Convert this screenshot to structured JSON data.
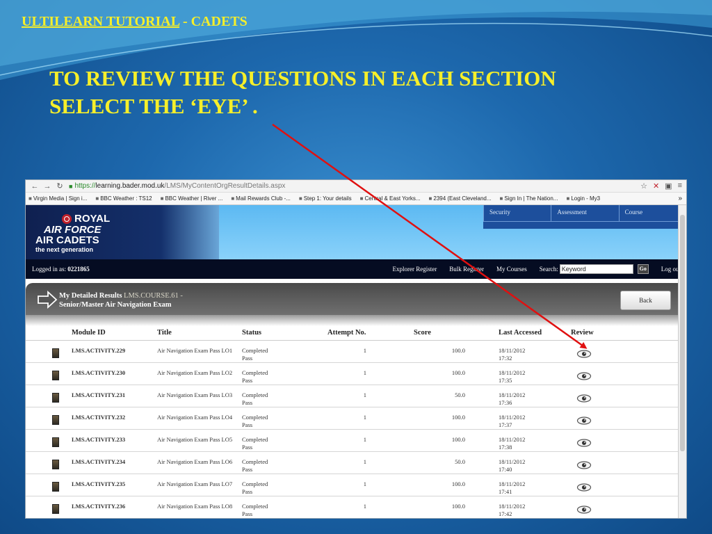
{
  "slide": {
    "title_underlined": "ULTILEARN TUTORIAL",
    "title_suffix": "- CADETS",
    "heading_line1": "TO REVIEW THE QUESTIONS IN EACH SECTION",
    "heading_line2": "SELECT THE ‘EYE’ ."
  },
  "browser": {
    "url_scheme": "https://",
    "url_host": "learning.bader.mod.uk",
    "url_path": "/LMS/MyContentOrgResultDetails.aspx",
    "bookmarks": [
      "Virgin Media | Sign i...",
      "BBC Weather : TS12",
      "BBC Weather | River ...",
      "Mail Rewards Club -...",
      "Step 1: Your details",
      "Central & East Yorks...",
      "2394 (East Cleveland...",
      "Sign In | The Nation...",
      "Login - My3"
    ],
    "bookmarks_more": "»"
  },
  "site": {
    "logo": {
      "line1": "ROYAL",
      "line2": "AIR FORCE",
      "line3": "AIR CADETS",
      "line4": "the next generation"
    },
    "top_tabs": [
      "Security",
      "Assessment",
      "Course"
    ],
    "logged_label": "Logged in as:",
    "user_id": "0221865",
    "menu": {
      "explorer": "Explorer Register",
      "bulk": "Bulk Register",
      "courses": "My Courses",
      "search_label": "Search:",
      "search_value": "Keyword",
      "go": "Go",
      "logout": "Log out"
    },
    "banner": {
      "label": "My Detailed Results",
      "course_code": "LMS.COURSE.61 -",
      "course_name": "Senior/Master Air Navigation Exam",
      "back": "Back"
    }
  },
  "table": {
    "headers": {
      "module_id": "Module ID",
      "title": "Title",
      "status": "Status",
      "attempt": "Attempt No.",
      "score": "Score",
      "last_accessed": "Last Accessed",
      "review": "Review"
    },
    "rows": [
      {
        "module": "LMS.ACTIVITY.229",
        "title": "Air Navigation Exam Pass LO1",
        "status1": "Completed",
        "status2": "Pass",
        "attempt": "1",
        "score": "100.0",
        "date": "18/11/2012",
        "time": "17:32"
      },
      {
        "module": "LMS.ACTIVITY.230",
        "title": "Air Navigation Exam Pass LO2",
        "status1": "Completed",
        "status2": "Pass",
        "attempt": "1",
        "score": "100.0",
        "date": "18/11/2012",
        "time": "17:35"
      },
      {
        "module": "LMS.ACTIVITY.231",
        "title": "Air Navigation Exam Pass LO3",
        "status1": "Completed",
        "status2": "Pass",
        "attempt": "1",
        "score": "50.0",
        "date": "18/11/2012",
        "time": "17:36"
      },
      {
        "module": "LMS.ACTIVITY.232",
        "title": "Air Navigation Exam Pass LO4",
        "status1": "Completed",
        "status2": "Pass",
        "attempt": "1",
        "score": "100.0",
        "date": "18/11/2012",
        "time": "17:37"
      },
      {
        "module": "LMS.ACTIVITY.233",
        "title": "Air Navigation Exam Pass LO5",
        "status1": "Completed",
        "status2": "Pass",
        "attempt": "1",
        "score": "100.0",
        "date": "18/11/2012",
        "time": "17:38"
      },
      {
        "module": "LMS.ACTIVITY.234",
        "title": "Air Navigation Exam Pass LO6",
        "status1": "Completed",
        "status2": "Pass",
        "attempt": "1",
        "score": "50.0",
        "date": "18/11/2012",
        "time": "17:40"
      },
      {
        "module": "LMS.ACTIVITY.235",
        "title": "Air Navigation Exam Pass LO7",
        "status1": "Completed",
        "status2": "Pass",
        "attempt": "1",
        "score": "100.0",
        "date": "18/11/2012",
        "time": "17:41"
      },
      {
        "module": "LMS.ACTIVITY.236",
        "title": "Air Navigation Exam Pass LO8",
        "status1": "Completed",
        "status2": "Pass",
        "attempt": "1",
        "score": "100.0",
        "date": "18/11/2012",
        "time": "17:42"
      }
    ]
  },
  "icons": {
    "review": "eye-icon",
    "module": "document-icon",
    "banner": "right-arrow-icon"
  },
  "colors": {
    "slide_text": "#f6ef2a",
    "pointer_arrow": "#e01010",
    "site_nav": "#050c22",
    "tabs": "#1d4f9c"
  }
}
